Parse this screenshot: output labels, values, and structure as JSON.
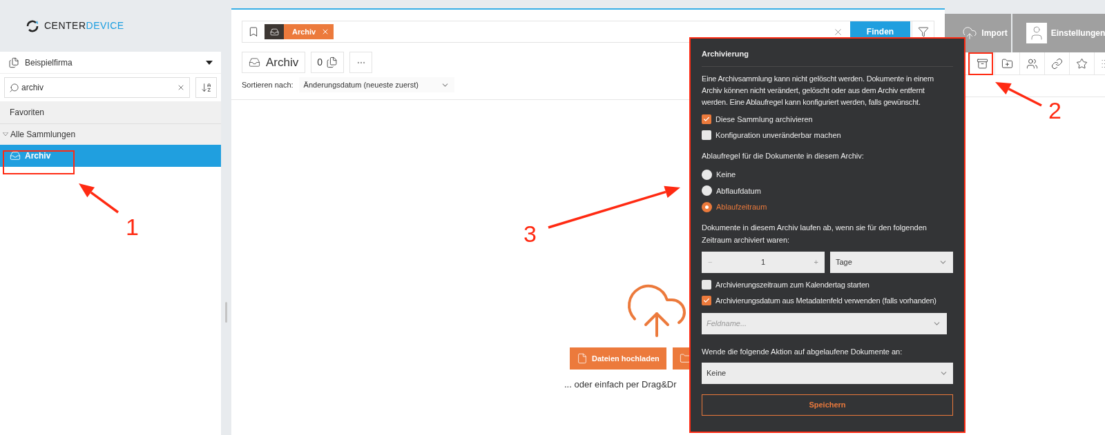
{
  "logo": {
    "part_1": "CENTER",
    "part_2": "DEVICE"
  },
  "workspace": {
    "label": "Beispielfirma"
  },
  "sidebar_search": {
    "value": "archiv"
  },
  "sidebar": {
    "favorites_label": "Favoriten",
    "section": {
      "label": "Alle Sammlungen",
      "expanded": true
    },
    "items": [
      {
        "label": "Archiv",
        "selected": true
      }
    ]
  },
  "search_bar": {
    "tag": "Archiv",
    "find_button": "Finden"
  },
  "collection": {
    "title": "Archiv",
    "document_count": "0"
  },
  "sort": {
    "label": "Sortieren nach:",
    "value": "Änderungsdatum (neueste zuerst)"
  },
  "upload": {
    "buttons": [
      {
        "label": "Dateien hochladen",
        "kind": "file"
      },
      {
        "kind": "folder"
      }
    ],
    "hint": "... oder einfach per Drag&Dr"
  },
  "header_buttons": [
    {
      "label": "Import",
      "kind": "import"
    },
    {
      "label": "Einstellungen",
      "kind": "settings"
    }
  ],
  "archive_panel": {
    "title": "Archivierung",
    "description": "Eine Archivsammlung kann nicht gelöscht werden. Dokumente in einem Archiv können nicht verändert, gelöscht oder aus dem Archiv entfernt werden. Eine Ablaufregel kann konfiguriert werden, falls gewünscht.",
    "options": [
      {
        "label": "Diese Sammlung archivieren",
        "checked": true
      },
      {
        "label": "Konfiguration unveränderbar machen",
        "checked": false
      }
    ],
    "rule_label": "Ablaufregel für die Dokumente in diesem Archiv:",
    "rules": [
      {
        "label": "Keine",
        "selected": false
      },
      {
        "label": "Abflaufdatum",
        "selected": false
      },
      {
        "label": "Ablaufzeitraum",
        "selected": true
      }
    ],
    "period_label": "Dokumente in diesem Archiv laufen ab, wenn sie für den folgenden Zeitraum archiviert waren:",
    "period": {
      "decrement": "−",
      "value": "1",
      "increment": "+",
      "unit": "Tage"
    },
    "more_options": [
      {
        "label": "Archivierungszeitraum zum Kalendertag starten",
        "checked": false
      },
      {
        "label": "Archivierungsdatum aus Metadatenfeld verwenden (falls vorhanden)",
        "checked": true
      }
    ],
    "field": {
      "placeholder": "Feldname..."
    },
    "action_label": "Wende die folgende Aktion auf abgelaufene Dokumente an:",
    "action": {
      "value": "Keine"
    },
    "save": "Speichern"
  },
  "annotations": [
    {
      "label": "1"
    },
    {
      "label": "2"
    },
    {
      "label": "3"
    }
  ]
}
